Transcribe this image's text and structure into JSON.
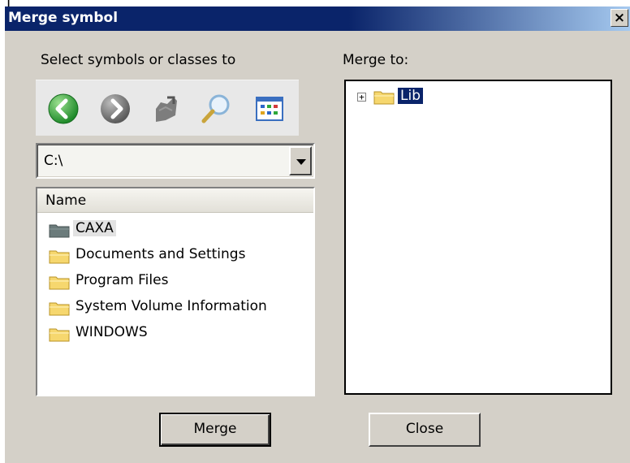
{
  "window": {
    "title": "Merge symbol",
    "close_label": "×"
  },
  "left": {
    "label": "Select symbols or classes to",
    "toolbar": [
      {
        "icon": "back-arrow-icon",
        "color": "#2fa83a"
      },
      {
        "icon": "forward-arrow-icon",
        "color": "#7a7a7a"
      },
      {
        "icon": "up-folder-icon",
        "color": "#6d6d6d"
      },
      {
        "icon": "search-icon",
        "color": "#8ab4d8"
      },
      {
        "icon": "view-grid-icon",
        "color": "#3a6fc0"
      }
    ],
    "path_value": "C:\\",
    "list_header": "Name",
    "items": [
      {
        "label": "CAXA",
        "selected": true
      },
      {
        "label": "Documents and Settings",
        "selected": false
      },
      {
        "label": "Program Files",
        "selected": false
      },
      {
        "label": "System Volume Information",
        "selected": false
      },
      {
        "label": "WINDOWS",
        "selected": false
      }
    ]
  },
  "right": {
    "label": "Merge to:",
    "tree": [
      {
        "label": "Lib",
        "expander": "+",
        "selected": true
      }
    ]
  },
  "buttons": {
    "merge": "Merge",
    "close": "Close"
  },
  "colors": {
    "title_bar": "#0a246a",
    "dialog_bg": "#d4d0c8",
    "selection": "#0a246a"
  }
}
